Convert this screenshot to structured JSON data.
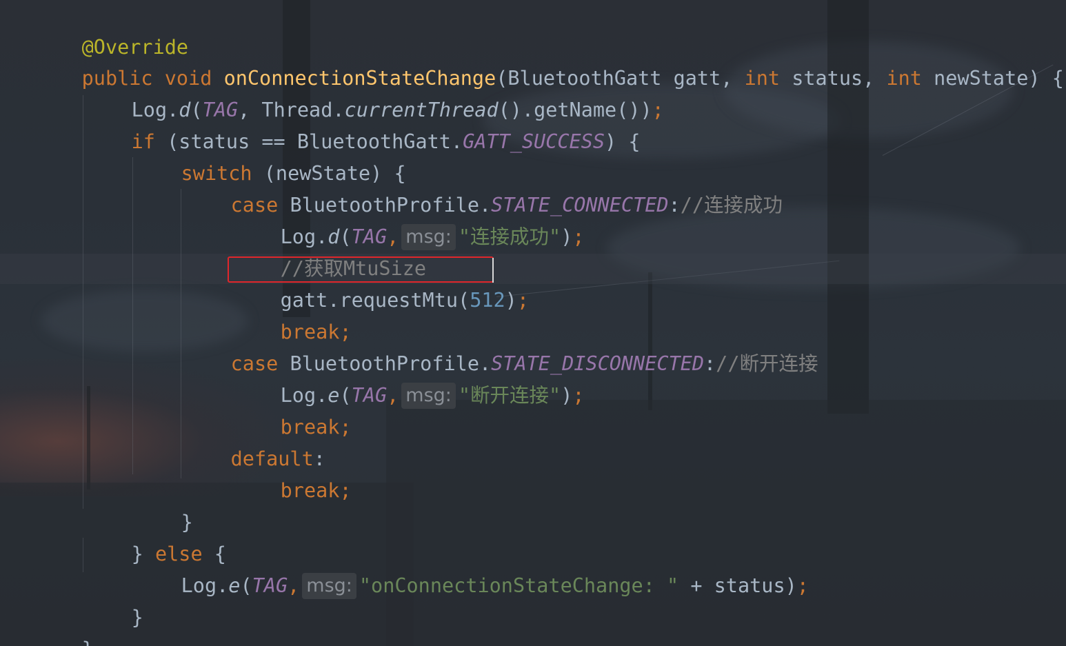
{
  "editor": {
    "lines": [
      {
        "id": "annotation",
        "text": "@Override"
      },
      {
        "id": "signature",
        "kw_public": "public",
        "kw_void": "void",
        "method": "onConnectionStateChange",
        "p1": "(BluetoothGatt gatt, ",
        "kw_int1": "int",
        "p2": " status, ",
        "kw_int2": "int",
        "p3": " newState) {"
      },
      {
        "id": "log-thread",
        "a": "Log.",
        "b": "d",
        "c": "(",
        "tag": "TAG",
        "d": ", Thread.",
        "e": "currentThread",
        "f": "().getName())",
        "semi": ";"
      },
      {
        "id": "if-status",
        "kw": "if",
        "a": " (status == BluetoothGatt.",
        "const": "GATT_SUCCESS",
        "b": ") {"
      },
      {
        "id": "switch",
        "kw": "switch",
        "a": " (newState) {"
      },
      {
        "id": "case-connected",
        "kw": "case",
        "a": " BluetoothProfile.",
        "const": "STATE_CONNECTED",
        "b": ":",
        "comment": "//连接成功"
      },
      {
        "id": "log-connected",
        "a": "Log.",
        "b": "d",
        "c": "(",
        "tag": "TAG",
        "comma": ",",
        "hint": "msg:",
        "str": "\"连接成功\"",
        "d": ")",
        "semi": ";"
      },
      {
        "id": "comment-mtu",
        "comment": "//获取MtuSize"
      },
      {
        "id": "request-mtu",
        "a": "gatt.requestMtu(",
        "num": "512",
        "b": ")",
        "semi": ";"
      },
      {
        "id": "break-1",
        "kw": "break",
        "semi": ";"
      },
      {
        "id": "case-disconnected",
        "kw": "case",
        "a": " BluetoothProfile.",
        "const": "STATE_DISCONNECTED",
        "b": ":",
        "comment": "//断开连接"
      },
      {
        "id": "log-disconnected",
        "a": "Log.",
        "b": "e",
        "c": "(",
        "tag": "TAG",
        "comma": ",",
        "hint": "msg:",
        "str": "\"断开连接\"",
        "d": ")",
        "semi": ";"
      },
      {
        "id": "break-2",
        "kw": "break",
        "semi": ";"
      },
      {
        "id": "default",
        "kw": "default",
        "b": ":"
      },
      {
        "id": "break-3",
        "kw": "break",
        "semi": ";"
      },
      {
        "id": "close-switch",
        "a": "}"
      },
      {
        "id": "else",
        "a": "} ",
        "kw": "else",
        "b": " {"
      },
      {
        "id": "log-else",
        "a": "Log.",
        "b": "e",
        "c": "(",
        "tag": "TAG",
        "comma": ",",
        "hint": "msg:",
        "str": "\"onConnectionStateChange: \"",
        "d": " + status)",
        "semi": ";"
      },
      {
        "id": "close-else",
        "a": "}"
      },
      {
        "id": "close-method",
        "a": "}"
      }
    ]
  },
  "colors": {
    "keyword": "#cc7832",
    "method_decl": "#ffc66d",
    "annotation": "#bbb529",
    "static_field": "#9876aa",
    "string": "#6a8759",
    "number": "#6897bb",
    "comment": "#808080",
    "default_text": "#a9b7c6",
    "highlight_border": "#e0262b"
  }
}
